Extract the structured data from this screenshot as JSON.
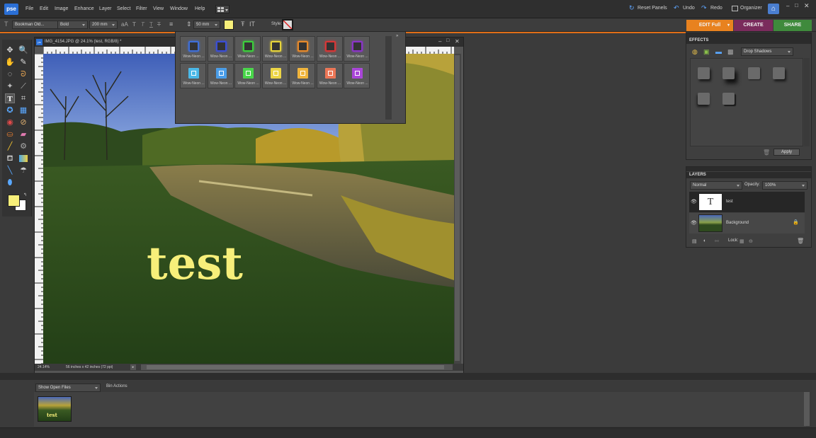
{
  "app": {
    "logo": "pse"
  },
  "menu": [
    "File",
    "Edit",
    "Image",
    "Enhance",
    "Layer",
    "Select",
    "Filter",
    "View",
    "Window",
    "Help"
  ],
  "topright": {
    "reset_panels": "Reset Panels",
    "undo": "Undo",
    "redo": "Redo",
    "organizer": "Organizer"
  },
  "options": {
    "font_family": "Bookman Old...",
    "font_style": "Bold",
    "font_size": "200 mm",
    "leading": "50 mm",
    "style_label": "Style:",
    "color": "#f7ef7a"
  },
  "modes": {
    "edit": "EDIT Full",
    "create": "CREATE",
    "share": "SHARE"
  },
  "document": {
    "title": "IMG_4154.JPG @ 24.1% (test, RGB/8) *",
    "zoom": "24.14%",
    "info": "56 inches x 42 inches (72 ppi)",
    "canvas_text": "test"
  },
  "styles_popup": {
    "items": [
      {
        "label": "Wow-Neon ...",
        "color": "#3f6fd8",
        "row": 0
      },
      {
        "label": "Wow-Neon ...",
        "color": "#3a4ed6",
        "row": 0
      },
      {
        "label": "Wow-Neon ...",
        "color": "#3ccf3c",
        "row": 0
      },
      {
        "label": "Wow-Neon ...",
        "color": "#e7d43a",
        "row": 0
      },
      {
        "label": "Wow-Neon ...",
        "color": "#e88a2a",
        "row": 0
      },
      {
        "label": "Wow-Neon ...",
        "color": "#d83636",
        "row": 0
      },
      {
        "label": "Wow-Neon ...",
        "color": "#8b34c8",
        "row": 0
      },
      {
        "label": "Wow-Neon ...",
        "color": "#4ab8e8",
        "row": 1
      },
      {
        "label": "Wow-Neon ...",
        "color": "#4a9de8",
        "row": 1
      },
      {
        "label": "Wow-Neon ...",
        "color": "#49d64a",
        "row": 1
      },
      {
        "label": "Wow-Neon ...",
        "color": "#ecd546",
        "row": 1
      },
      {
        "label": "Wow-Neon ...",
        "color": "#f0b43c",
        "row": 1
      },
      {
        "label": "Wow-Neon ...",
        "color": "#ec7656",
        "row": 1
      },
      {
        "label": "Wow-Neon ...",
        "color": "#a945d8",
        "row": 1
      }
    ]
  },
  "effects": {
    "title": "EFFECTS",
    "category": "Drop Shadows",
    "apply": "Apply"
  },
  "layers": {
    "title": "LAYERS",
    "blend": "Normal",
    "opacity_label": "Opacity:",
    "opacity": "100%",
    "lock_label": "Lock:",
    "items": [
      {
        "name": "test"
      },
      {
        "name": "Background"
      }
    ]
  },
  "bin": {
    "show": "Show Open Files",
    "actions": "Bin Actions",
    "thumb_text": "test"
  }
}
